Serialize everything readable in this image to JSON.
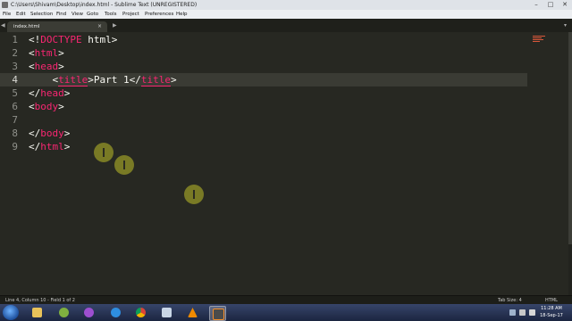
{
  "window": {
    "title": "C:\\Users\\Shivam\\Desktop\\index.html - Sublime Text (UNREGISTERED)",
    "minimize": "–",
    "maximize": "□",
    "close": "✕"
  },
  "menu": [
    "File",
    "Edit",
    "Selection",
    "Find",
    "View",
    "Goto",
    "Tools",
    "Project",
    "Preferences",
    "Help"
  ],
  "tabs": {
    "nav_left": "◀",
    "nav_right": "▶",
    "active_tab": "index.html",
    "close_glyph": "×",
    "dropdown": "▾"
  },
  "editor": {
    "line_numbers": [
      "1",
      "2",
      "3",
      "4",
      "5",
      "6",
      "7",
      "8",
      "9"
    ],
    "lines": [
      {
        "pre": "<!",
        "tag": "DOCTYPE",
        "post": " html>"
      },
      {
        "pre": "<",
        "tag": "html",
        "post": ">"
      },
      {
        "pre": "<",
        "tag": "head",
        "post": ">"
      },
      {
        "indent": "    ",
        "pre": "<",
        "tag": "title",
        "mid": ">Part 1</",
        "tag2": "title",
        "post": ">"
      },
      {
        "pre": "</",
        "tag": "head",
        "post": ">"
      },
      {
        "pre": "<",
        "tag": "body",
        "post": ">"
      },
      {},
      {
        "pre": "</",
        "tag": "body",
        "post": ">"
      },
      {
        "pre": "</",
        "tag": "html",
        "post": ">"
      }
    ],
    "active_line": 4
  },
  "status": {
    "position": "Line 4, Column 10 - Field 1 of 2",
    "tab_size": "Tab Size: 4",
    "syntax": "HTML"
  },
  "taskbar": {
    "clock_time": "11:28 AM",
    "clock_date": "18-Sep-17"
  },
  "colors": {
    "editor_bg": "#272822",
    "tag": "#f92672",
    "text": "#f8f8f2",
    "line_number": "#8f908a"
  }
}
